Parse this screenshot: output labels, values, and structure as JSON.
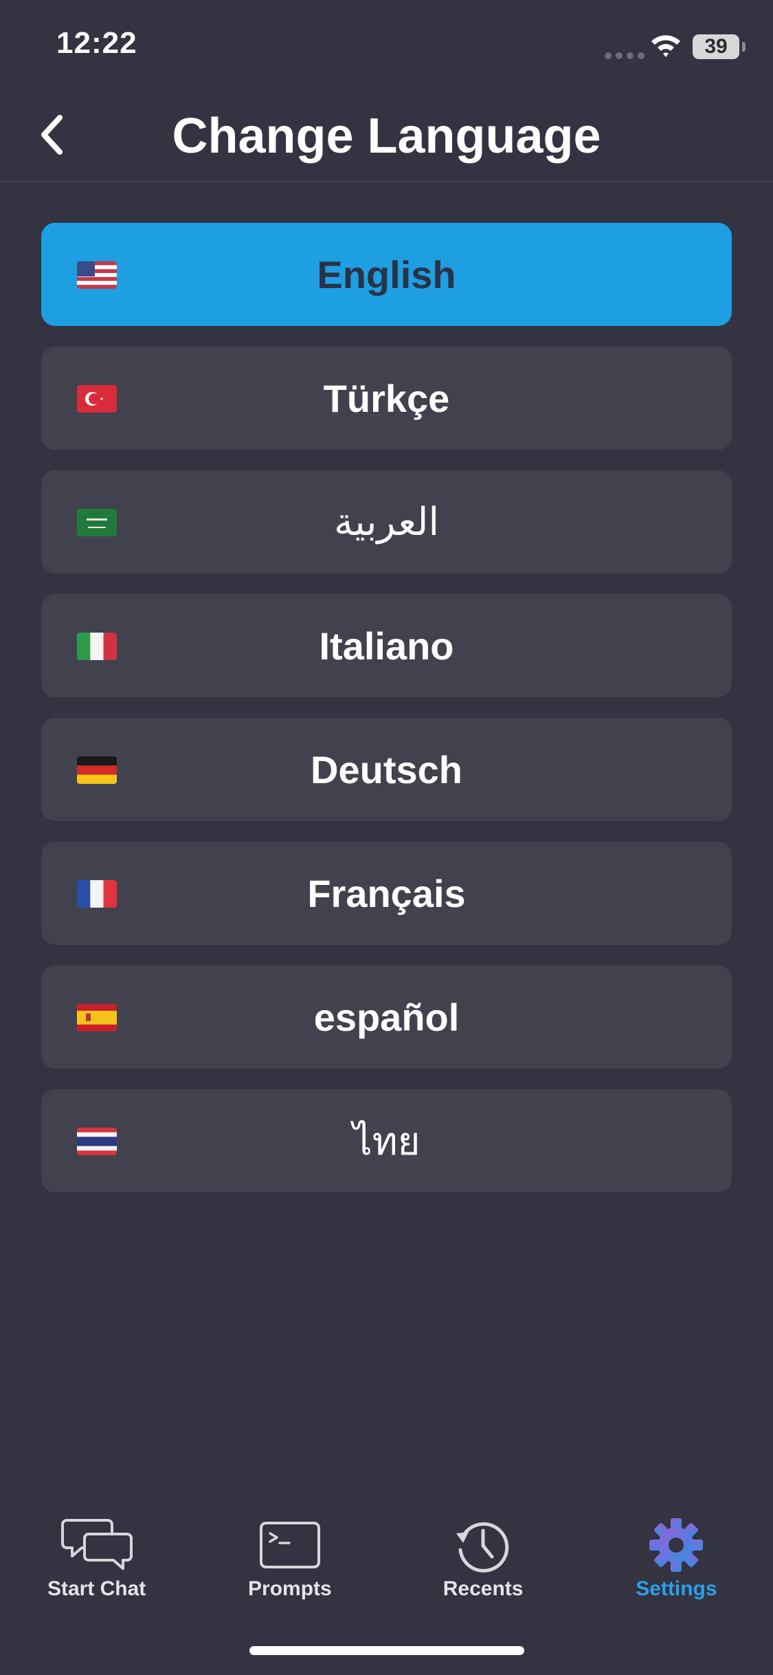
{
  "status_bar": {
    "time": "12:22",
    "battery": "39",
    "icons": [
      "signal-dots-icon",
      "wifi-icon",
      "battery-icon"
    ]
  },
  "header": {
    "title": "Change Language",
    "back_icon": "chevron-left-icon"
  },
  "languages": [
    {
      "label": "English",
      "flag": "us-flag-icon",
      "selected": true
    },
    {
      "label": "Türkçe",
      "flag": "turkey-flag-icon",
      "selected": false
    },
    {
      "label": "العربية",
      "flag": "saudi-arabia-flag-icon",
      "selected": false
    },
    {
      "label": "Italiano",
      "flag": "italy-flag-icon",
      "selected": false
    },
    {
      "label": "Deutsch",
      "flag": "germany-flag-icon",
      "selected": false
    },
    {
      "label": "Français",
      "flag": "france-flag-icon",
      "selected": false
    },
    {
      "label": "español",
      "flag": "spain-flag-icon",
      "selected": false
    },
    {
      "label": "ไทย",
      "flag": "thailand-flag-icon",
      "selected": false
    }
  ],
  "tab_bar": {
    "tabs": [
      {
        "label": "Start Chat",
        "icon": "chat-bubbles-icon",
        "active": false
      },
      {
        "label": "Prompts",
        "icon": "terminal-icon",
        "active": false
      },
      {
        "label": "Recents",
        "icon": "history-clock-icon",
        "active": false
      },
      {
        "label": "Settings",
        "icon": "gear-icon",
        "active": true
      }
    ]
  },
  "colors": {
    "background": "#333342",
    "item_background": "#42424f",
    "selected_accent": "#1e9fe2",
    "active_tab": "#2d9fe8"
  }
}
